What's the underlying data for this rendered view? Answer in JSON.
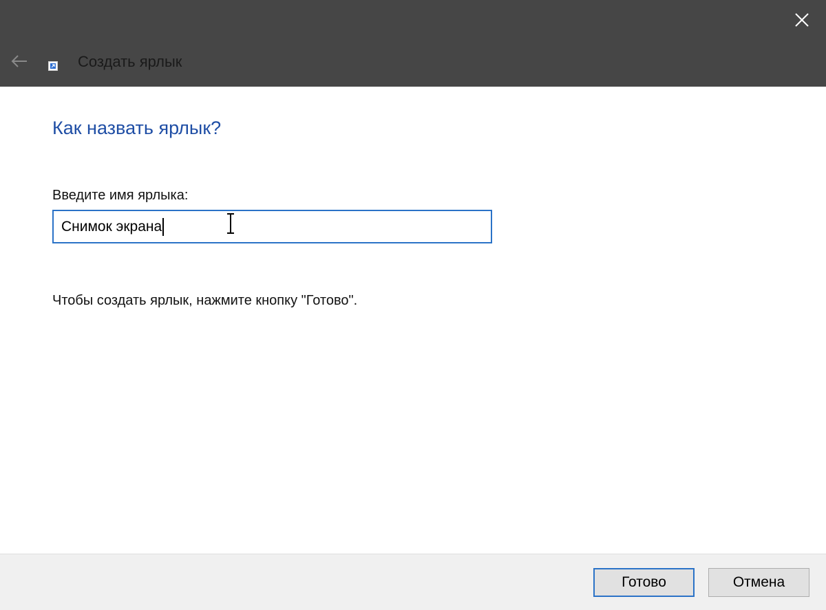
{
  "titlebar": {
    "title": "Создать ярлык",
    "back_icon": "back-arrow-icon",
    "close_icon": "close-icon",
    "background": "#464646"
  },
  "main": {
    "heading": "Как назвать ярлык?",
    "field_label": "Введите имя ярлыка:",
    "shortcut_name": "Снимок экрана",
    "hint": "Чтобы создать ярлык, нажмите кнопку \"Готово\".",
    "heading_color": "#1f4ea5"
  },
  "footer": {
    "finish_label": "Готово",
    "cancel_label": "Отмена",
    "accent": "#2a72c7"
  }
}
